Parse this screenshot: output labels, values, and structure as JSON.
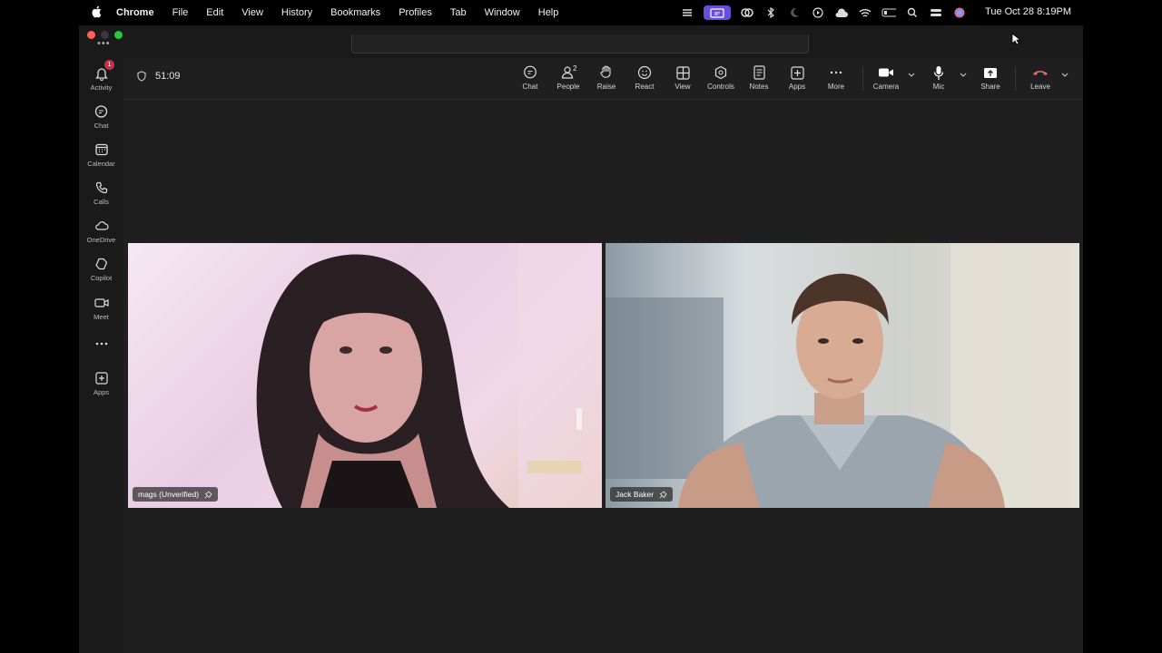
{
  "menubar": {
    "app_name": "Chrome",
    "items": [
      "File",
      "Edit",
      "View",
      "History",
      "Bookmarks",
      "Profiles",
      "Tab",
      "Window",
      "Help"
    ],
    "clock": "Tue Oct 28  8:19PM"
  },
  "rail": {
    "activity_badge": "1",
    "items": [
      {
        "label": "Activity",
        "icon": "bell-icon"
      },
      {
        "label": "Chat",
        "icon": "chat-icon"
      },
      {
        "label": "Calendar",
        "icon": "calendar-icon"
      },
      {
        "label": "Calls",
        "icon": "phone-icon"
      },
      {
        "label": "OneDrive",
        "icon": "cloud-icon"
      },
      {
        "label": "Copilot",
        "icon": "copilot-icon"
      },
      {
        "label": "Meet",
        "icon": "video-icon"
      },
      {
        "label": "",
        "icon": "more-icon"
      },
      {
        "label": "Apps",
        "icon": "add-app-icon"
      }
    ]
  },
  "meeting": {
    "timer": "51:09",
    "people_count": "2",
    "toolbar": {
      "chat": "Chat",
      "people": "People",
      "raise": "Raise",
      "react": "React",
      "view": "View",
      "controls": "Controls",
      "notes": "Notes",
      "apps": "Apps",
      "more": "More",
      "camera": "Camera",
      "mic": "Mic",
      "share": "Share",
      "leave": "Leave"
    },
    "participants": [
      {
        "name": "mags (Unverified)"
      },
      {
        "name": "Jack Baker"
      }
    ]
  },
  "colors": {
    "leave_red": "#e06b78",
    "badge_red": "#c4314b",
    "window_bg": "#1f1f1f"
  }
}
